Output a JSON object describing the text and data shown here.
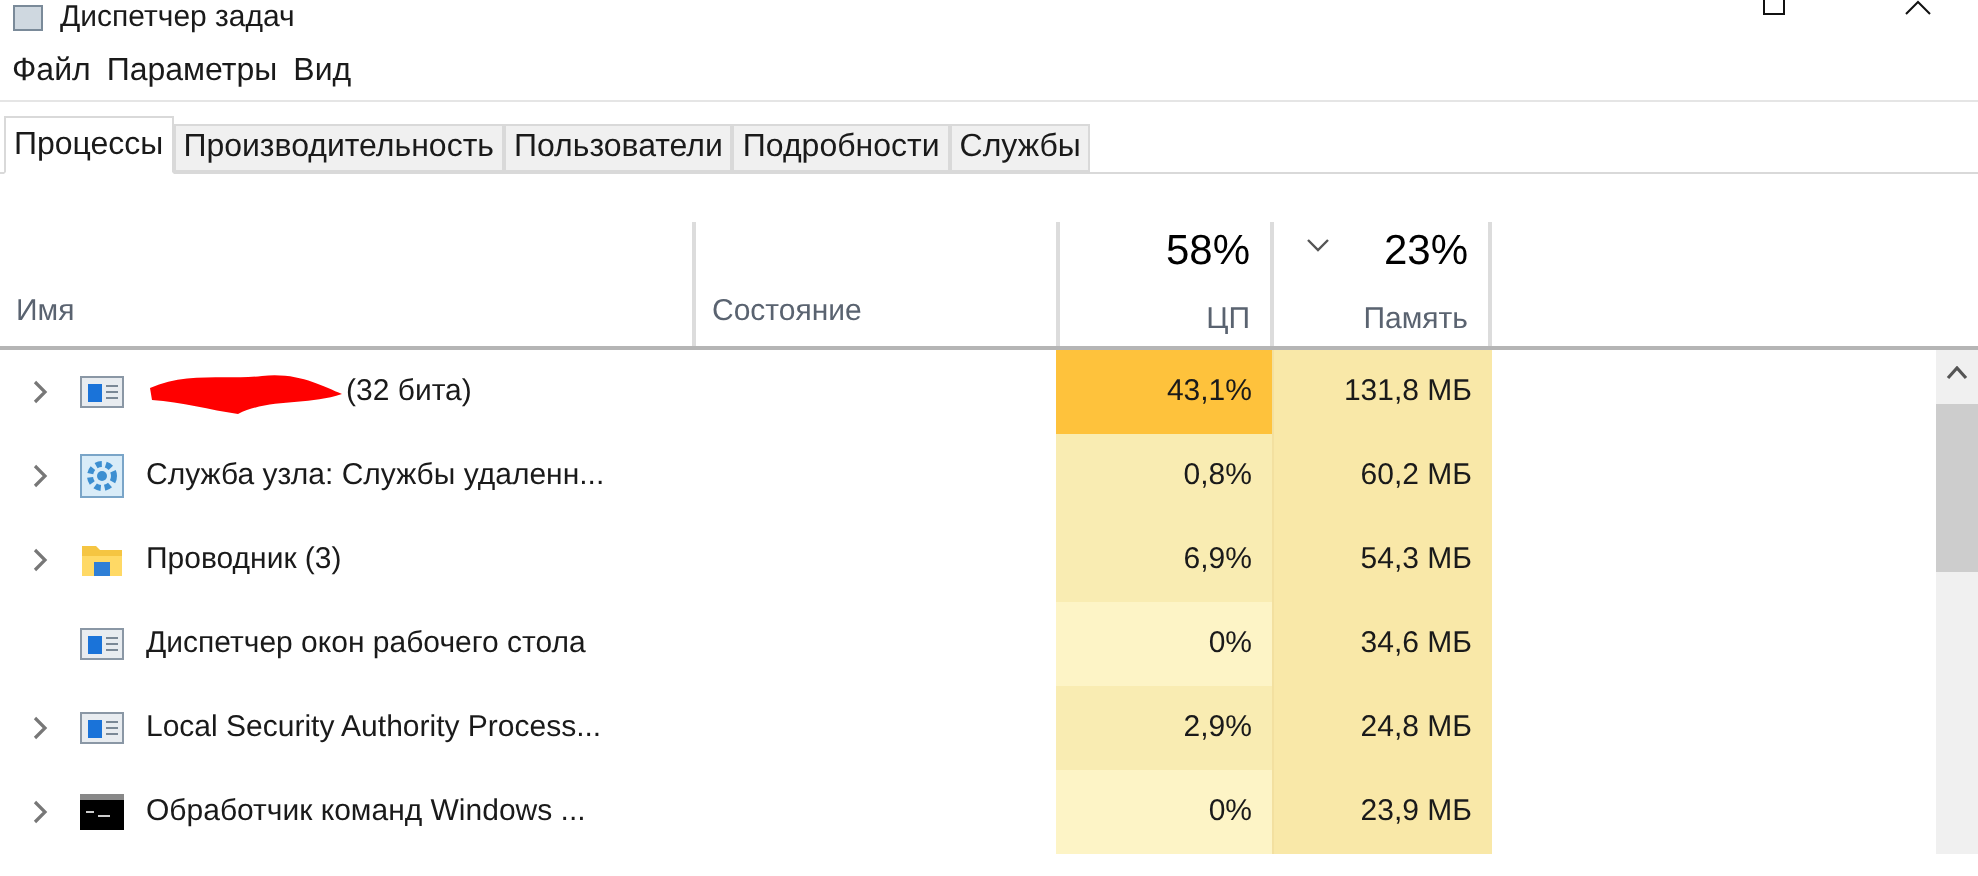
{
  "window": {
    "title": "Диспетчер задач"
  },
  "menu": [
    "Файл",
    "Параметры",
    "Вид"
  ],
  "tabs": [
    {
      "label": "Процессы",
      "selected": true
    },
    {
      "label": "Производительность",
      "selected": false
    },
    {
      "label": "Пользователи",
      "selected": false
    },
    {
      "label": "Подробности",
      "selected": false
    },
    {
      "label": "Службы",
      "selected": false
    }
  ],
  "columns": {
    "name": "Имя",
    "status": "Состояние",
    "cpu": {
      "total": "58%",
      "label": "ЦП"
    },
    "memory": {
      "total": "23%",
      "label": "Память",
      "sorted": true
    }
  },
  "rows": [
    {
      "kind": "app",
      "expandable": true,
      "redacted": true,
      "name": "(32 бита)",
      "cpu": {
        "text": "43,1%",
        "color": "#fec23c"
      },
      "memory": "131,8 МБ"
    },
    {
      "kind": "service",
      "expandable": true,
      "redacted": false,
      "name": "Служба узла: Службы удаленн...",
      "cpu": {
        "text": "0,8%",
        "color": "#f9ecb2"
      },
      "memory": "60,2 МБ"
    },
    {
      "kind": "explorer",
      "expandable": true,
      "redacted": false,
      "name": "Проводник (3)",
      "cpu": {
        "text": "6,9%",
        "color": "#f9ecb2"
      },
      "memory": "54,3 МБ"
    },
    {
      "kind": "app",
      "expandable": false,
      "redacted": false,
      "name": "Диспетчер окон рабочего стола",
      "cpu": {
        "text": "0%",
        "color": "#fdf4c6"
      },
      "memory": "34,6 МБ"
    },
    {
      "kind": "app",
      "expandable": true,
      "redacted": false,
      "name": "Local Security Authority Process...",
      "cpu": {
        "text": "2,9%",
        "color": "#f9ecb2"
      },
      "memory": "24,8 МБ"
    },
    {
      "kind": "console",
      "expandable": true,
      "redacted": false,
      "name": "Обработчик команд Windows ...",
      "cpu": {
        "text": "0%",
        "color": "#fdf4c6"
      },
      "memory": "23,9 МБ"
    }
  ]
}
